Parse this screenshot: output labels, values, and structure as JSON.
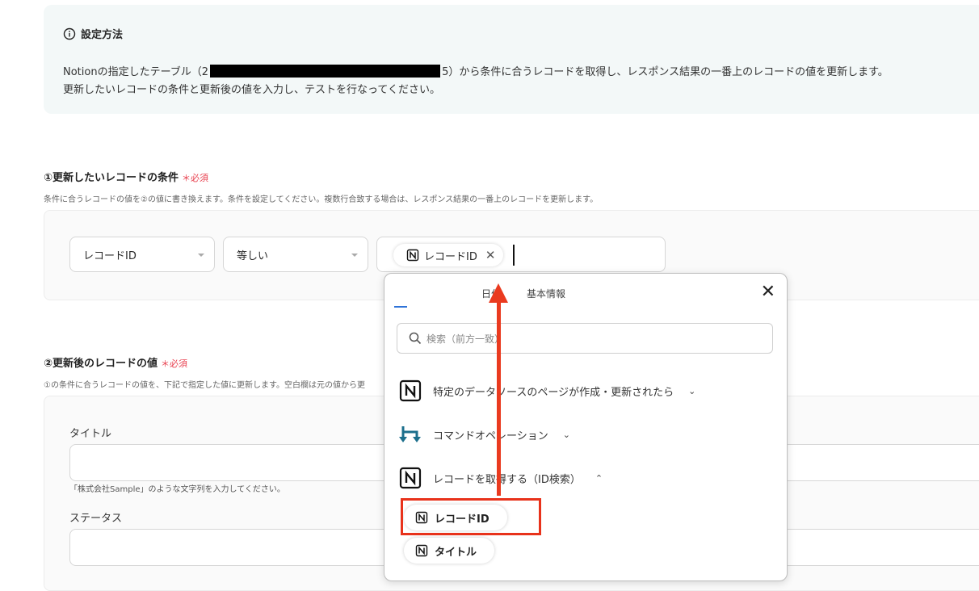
{
  "info": {
    "title": "設定方法",
    "line1_prefix": "Notionの指定したテーブル（2",
    "line1_suffix": "5）から条件に合うレコードを取得し、レスポンス結果の一番上のレコードの値を更新します。",
    "line2": "更新したいレコードの条件と更新後の値を入力し、テストを行なってください。"
  },
  "condition": {
    "label": "①更新したいレコードの条件",
    "required": "＊必須",
    "desc": "条件に合うレコードの値を②の値に書き換えます。条件を設定してください。複数行合致する場合は、レスポンス結果の一番上のレコードを更新します。",
    "field_select": "レコードID",
    "operator_select": "等しい",
    "value_chip": "レコードID"
  },
  "update": {
    "label": "②更新後のレコードの値",
    "required": "＊必須",
    "desc": "①の条件に合うレコードの値を、下記で指定した値に更新します。空白欄は元の値から更",
    "fields": [
      {
        "label": "タイトル",
        "hint": "「株式会社Sample」のような文字列を入力してください。"
      },
      {
        "label": "ステータス"
      }
    ]
  },
  "popup": {
    "tabs": [
      "日付",
      "基本情報"
    ],
    "search_placeholder": "検索（前方一致）",
    "groups": [
      {
        "label": "特定のデータソースのページが作成・更新されたら",
        "chevron": "down"
      },
      {
        "label": "コマンドオペレーション",
        "chevron": "down"
      },
      {
        "label": "レコードを取得する（ID検索）",
        "chevron": "up"
      }
    ],
    "items": [
      "レコードID",
      "タイトル"
    ]
  },
  "colors": {
    "accent_red": "#e8321b",
    "required_pink": "#e8404f",
    "info_bg": "#f3f8f8"
  }
}
